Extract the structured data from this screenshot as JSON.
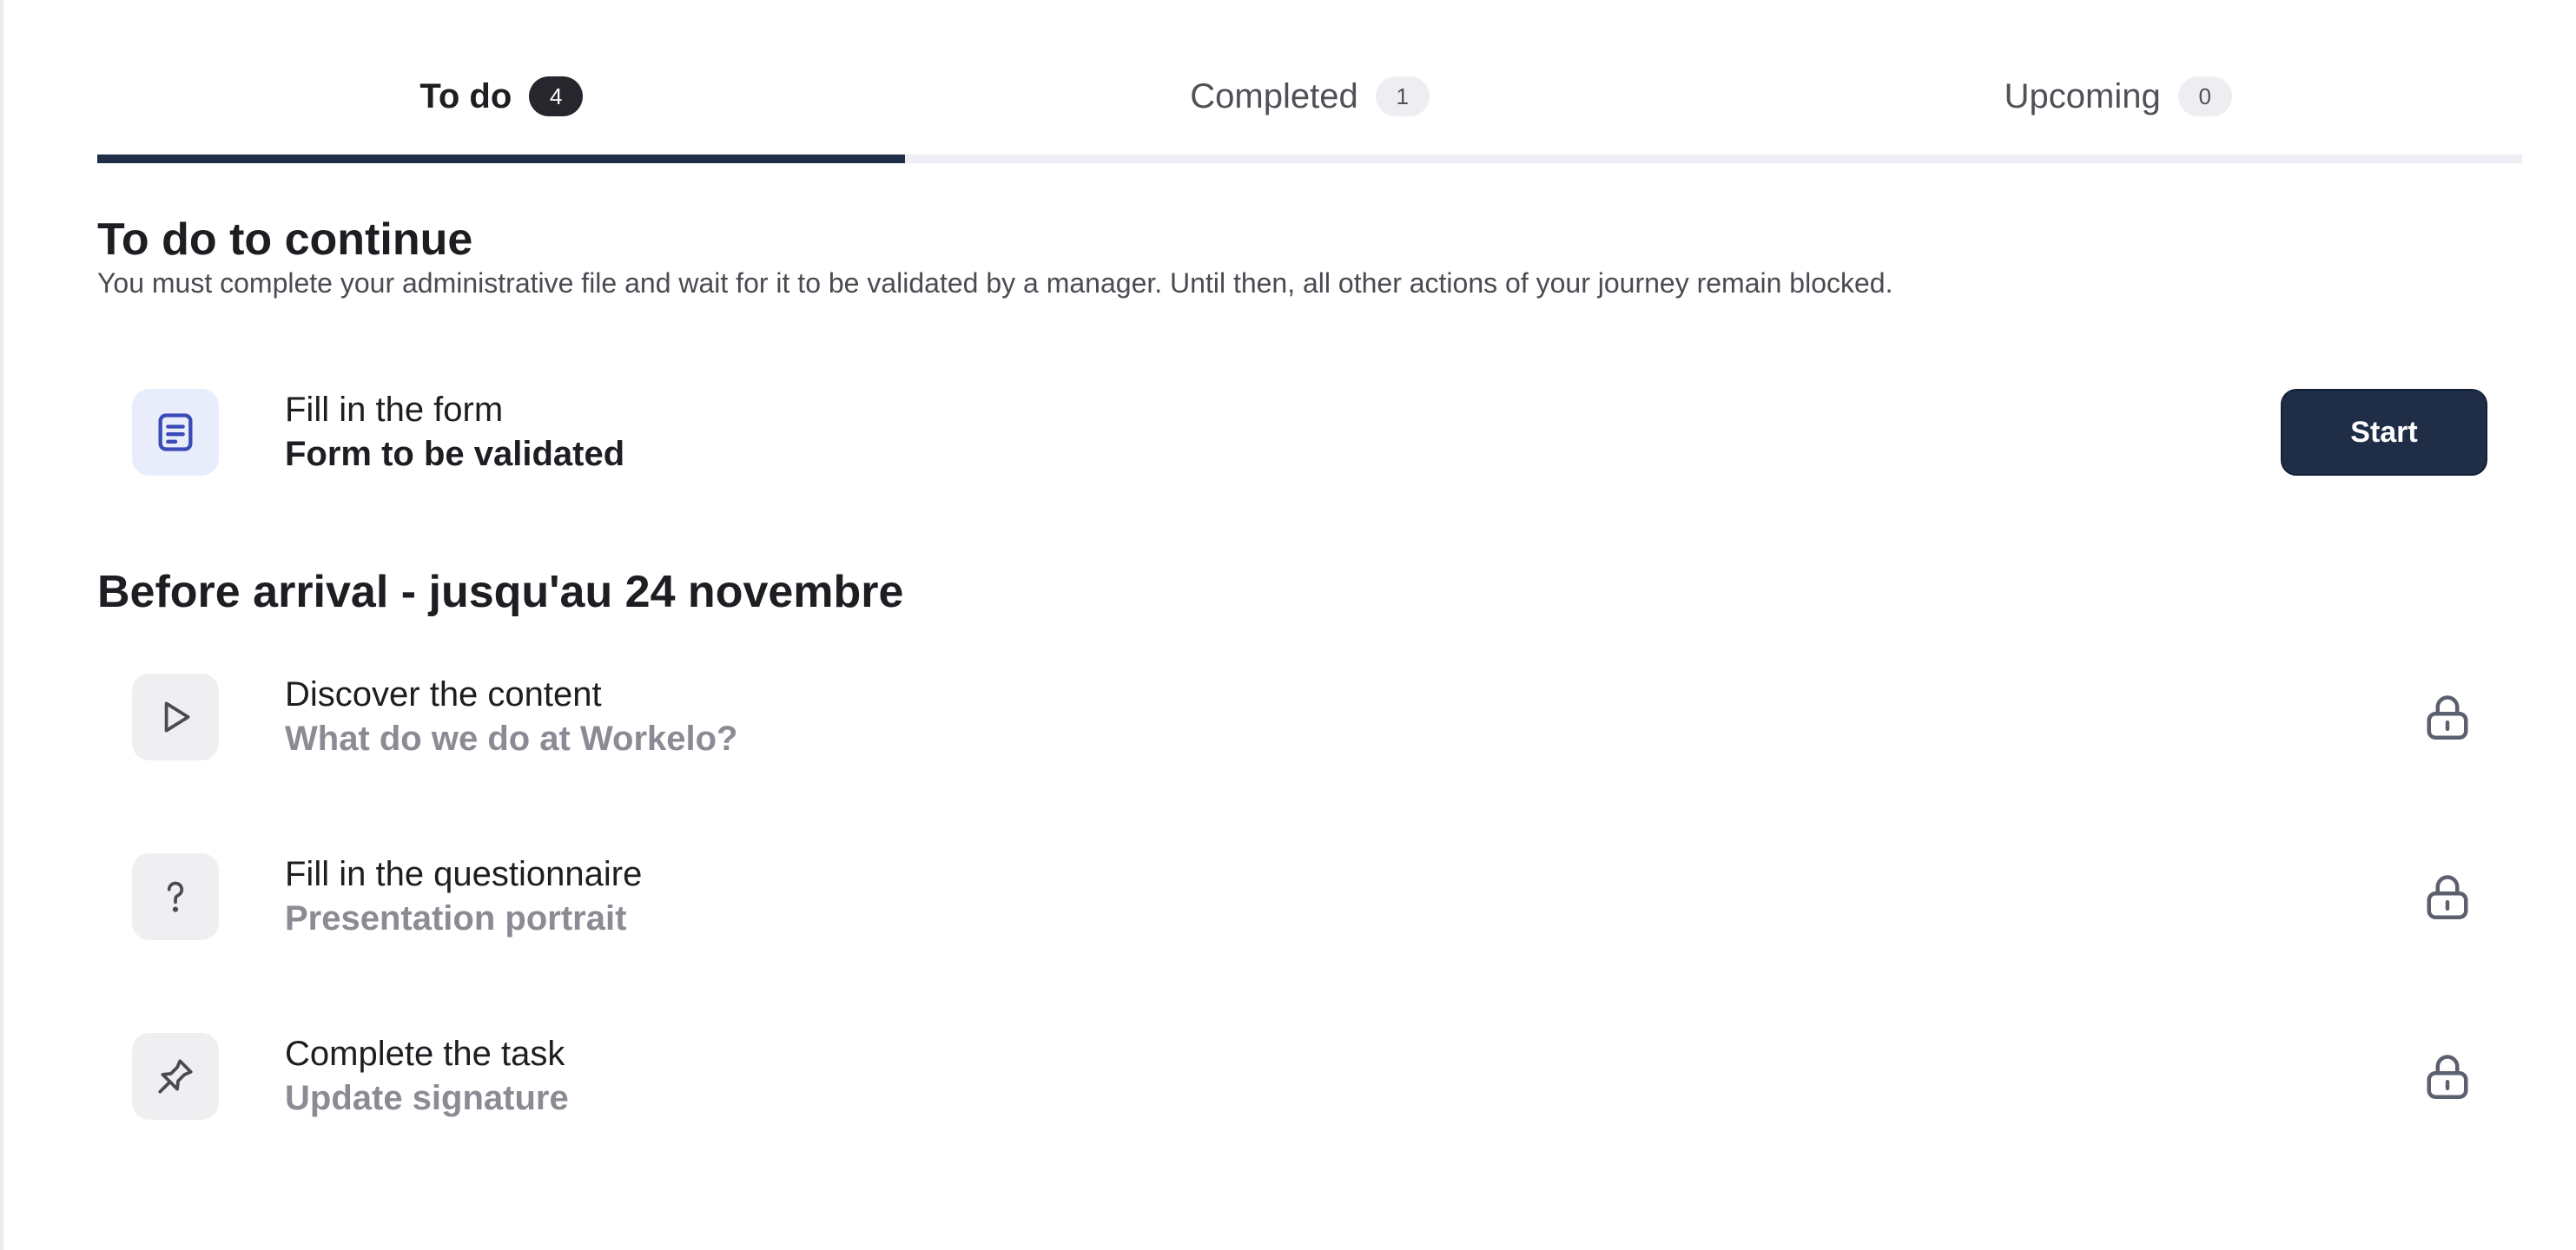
{
  "tabs": [
    {
      "label": "To do",
      "count": "4",
      "active": true
    },
    {
      "label": "Completed",
      "count": "1",
      "active": false
    },
    {
      "label": "Upcoming",
      "count": "0",
      "active": false
    }
  ],
  "blocking_section": {
    "title": "To do to continue",
    "description": "You must complete your administrative file and wait for it to be validated by a manager. Until then, all other actions of your journey remain blocked.",
    "task": {
      "icon": "document-icon",
      "type": "Fill in the form",
      "title": "Form to be validated",
      "button_label": "Start"
    }
  },
  "phase_section": {
    "title": "Before arrival - jusqu'au 24 novembre",
    "tasks": [
      {
        "icon": "play-icon",
        "type": "Discover the content",
        "title": "What do we do at Workelo?",
        "locked": true
      },
      {
        "icon": "question-mark-icon",
        "type": "Fill in the questionnaire",
        "title": "Presentation portrait",
        "locked": true
      },
      {
        "icon": "pin-icon",
        "type": "Complete the task",
        "title": "Update signature",
        "locked": true
      }
    ]
  },
  "colors": {
    "accent": "#1f2d46",
    "muted_text": "#8b8b94",
    "form_icon": "#3a4bb8"
  }
}
